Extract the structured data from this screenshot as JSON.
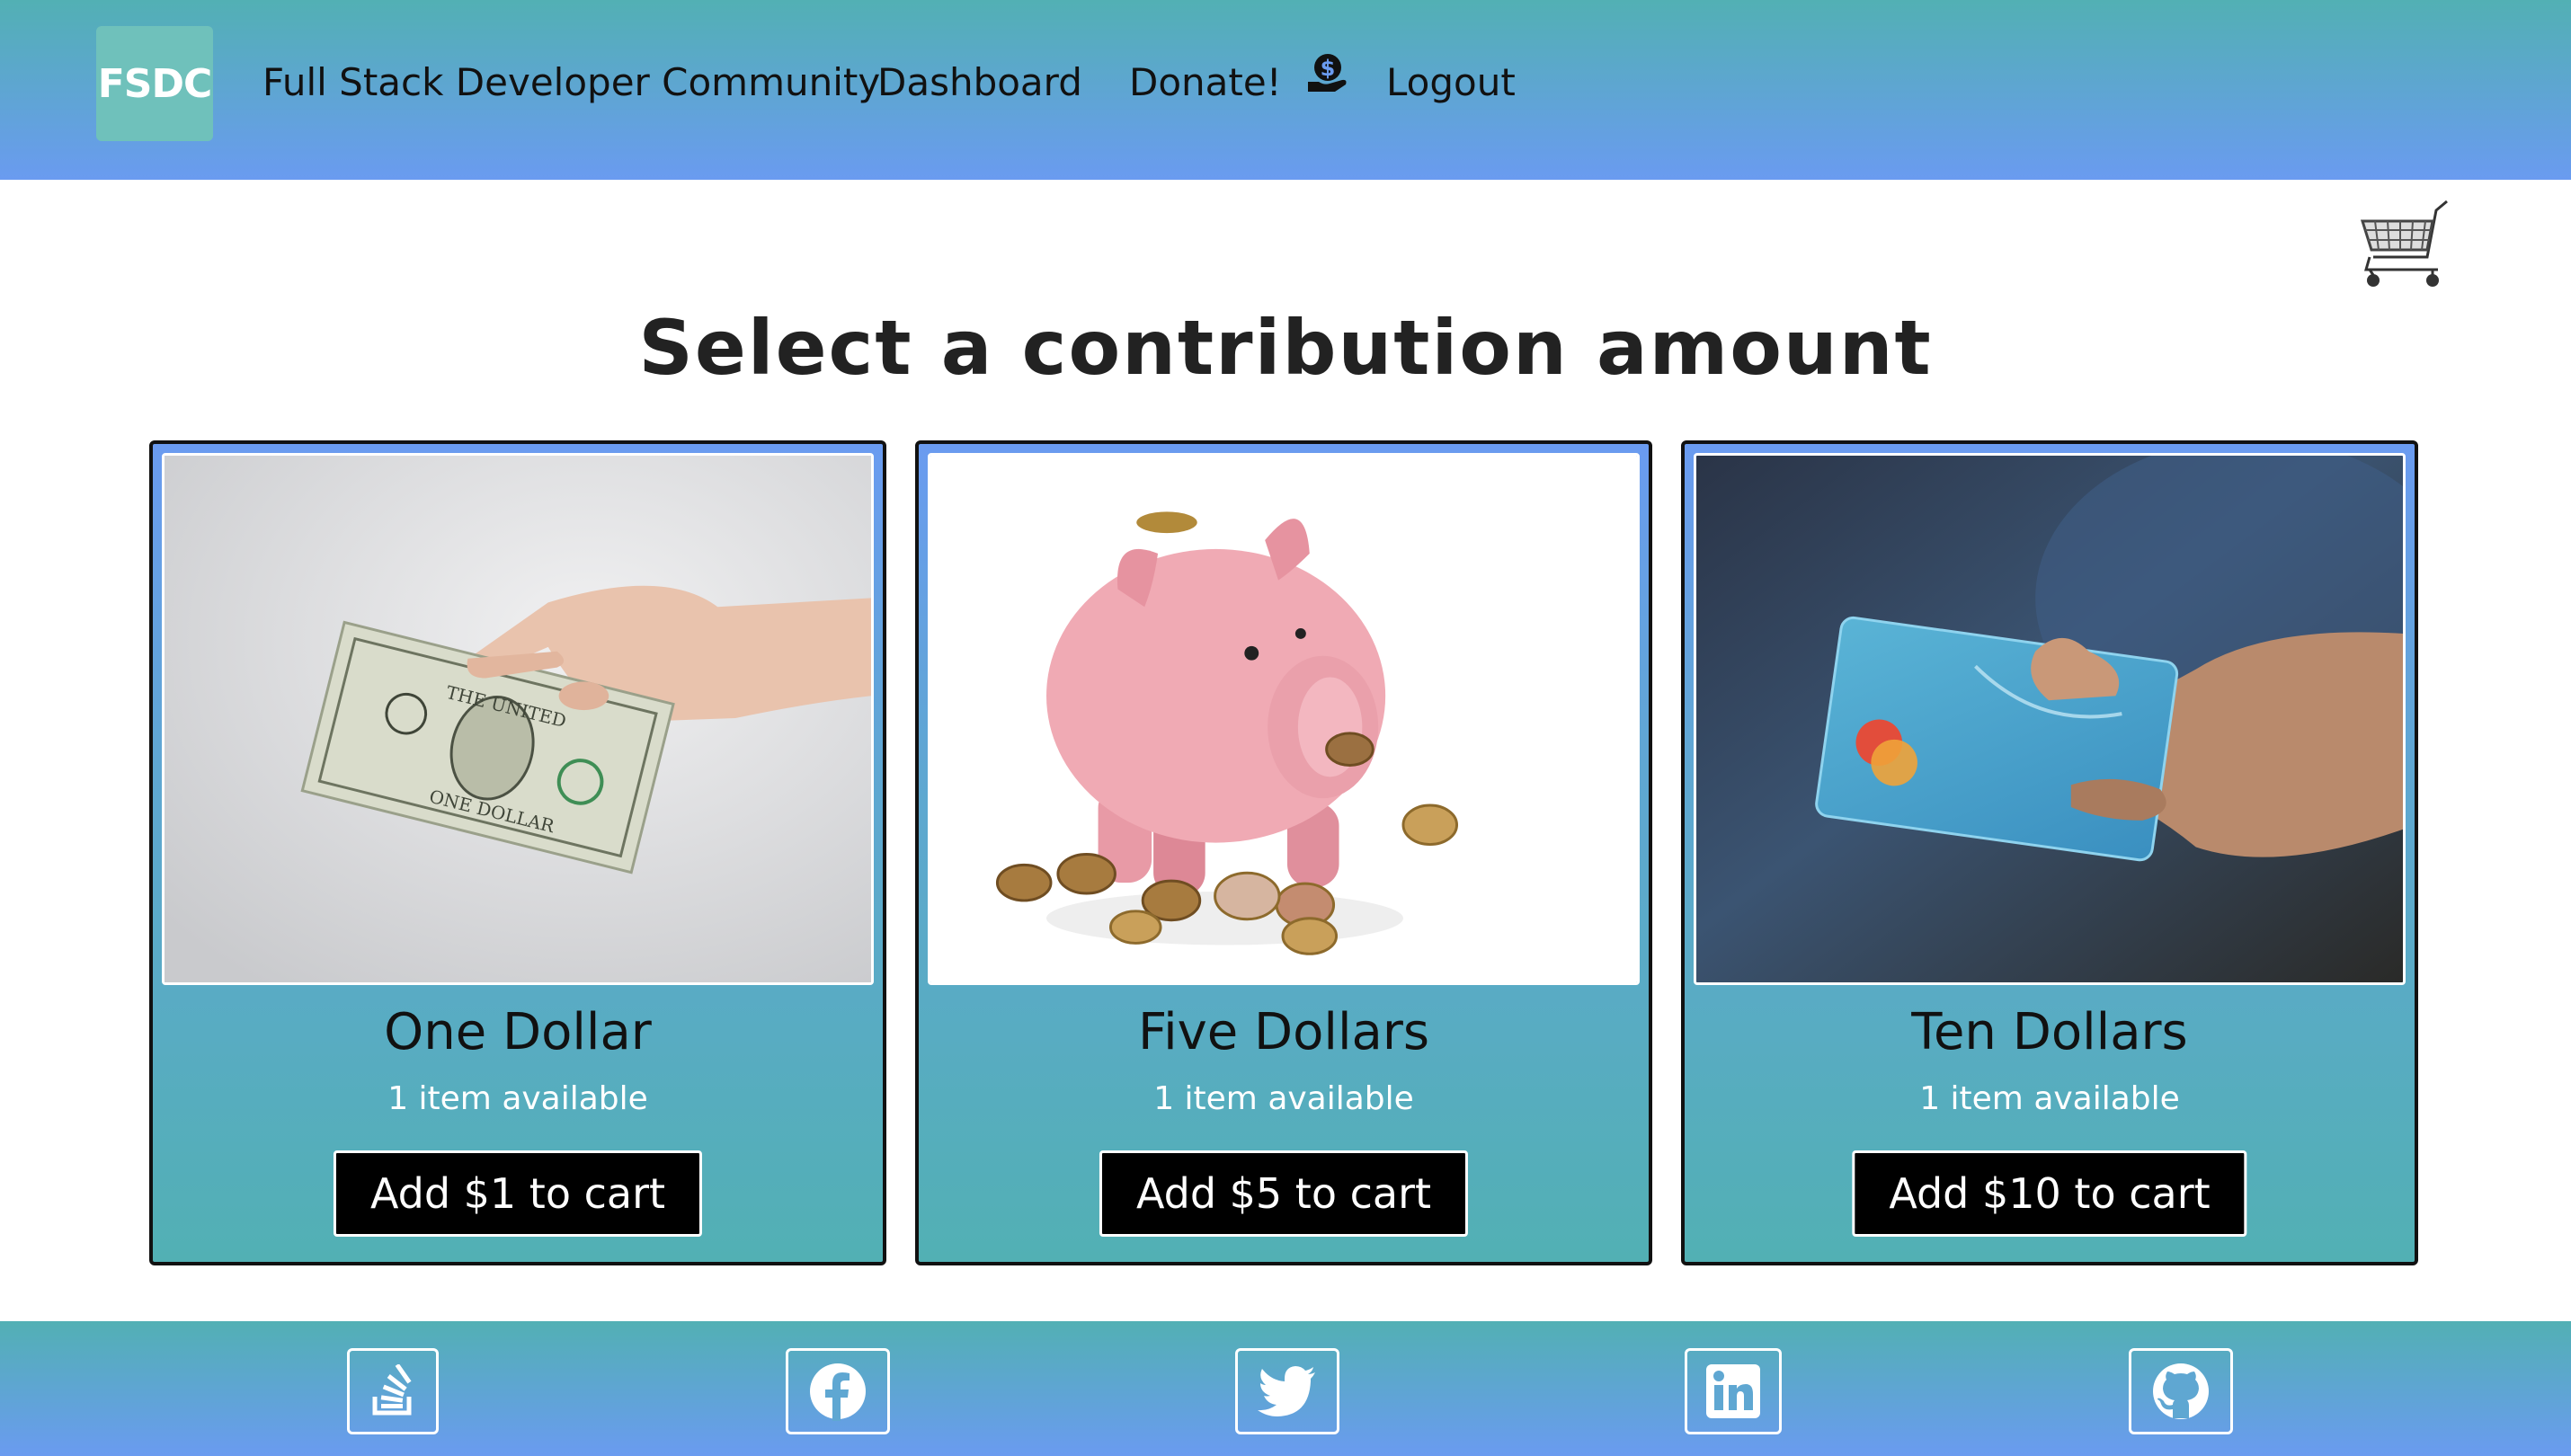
{
  "header": {
    "logo_text": "FSDC",
    "brand": "Full Stack Developer Community",
    "nav": {
      "dashboard": "Dashboard",
      "donate": "Donate!",
      "logout": "Logout"
    }
  },
  "main": {
    "title": "Select a contribution amount",
    "cards": [
      {
        "title": "One Dollar",
        "stock": "1 item available",
        "button": "Add $1 to cart",
        "image": "hand-holding-dollar-bill"
      },
      {
        "title": "Five Dollars",
        "stock": "1 item available",
        "button": "Add $5 to cart",
        "image": "piggy-bank-with-coins"
      },
      {
        "title": "Ten Dollars",
        "stock": "1 item available",
        "button": "Add $10 to cart",
        "image": "hand-holding-credit-card"
      }
    ]
  },
  "icons": {
    "donate": "hand-holding-dollar-icon",
    "cart": "shopping-cart-icon",
    "footer": [
      "stack-overflow-icon",
      "facebook-icon",
      "twitter-icon",
      "linkedin-icon",
      "github-icon"
    ]
  },
  "colors": {
    "gradient_top": "#52b0b4",
    "gradient_bottom": "#6a9bf0",
    "logo_bg": "#6fc1bb",
    "button_bg": "#000000"
  }
}
